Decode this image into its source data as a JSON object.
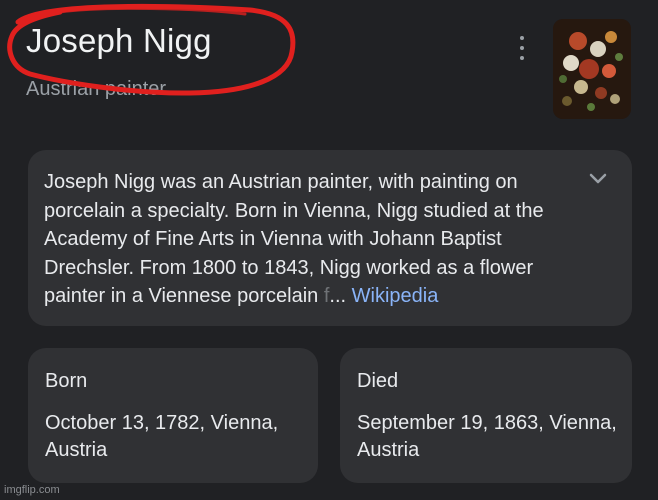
{
  "header": {
    "title": "Joseph Nigg",
    "subtitle": "Austrian painter"
  },
  "description": {
    "text": "Joseph Nigg was an Austrian painter, with painting on porcelain a specialty. Born in Vienna, Nigg studied at the Academy of Fine Arts in Vienna with Johann Baptist Drechsler. From 1800 to 1843, Nigg worked as a flower painter in a Viennese porcelain ",
    "faded": "f",
    "ellipsis": "...",
    "source_link": "Wikipedia"
  },
  "facts": {
    "born": {
      "label": "Born",
      "value": "October 13, 1782, Vienna, Austria"
    },
    "died": {
      "label": "Died",
      "value": "September 19, 1863, Vienna, Austria"
    }
  },
  "watermark": "imgflip.com",
  "icons": {
    "more": "more-vert-icon",
    "expand": "chevron-down-icon"
  },
  "colors": {
    "background": "#202124",
    "card": "#303134",
    "link": "#8ab4f8",
    "annotation": "#e0201e"
  }
}
